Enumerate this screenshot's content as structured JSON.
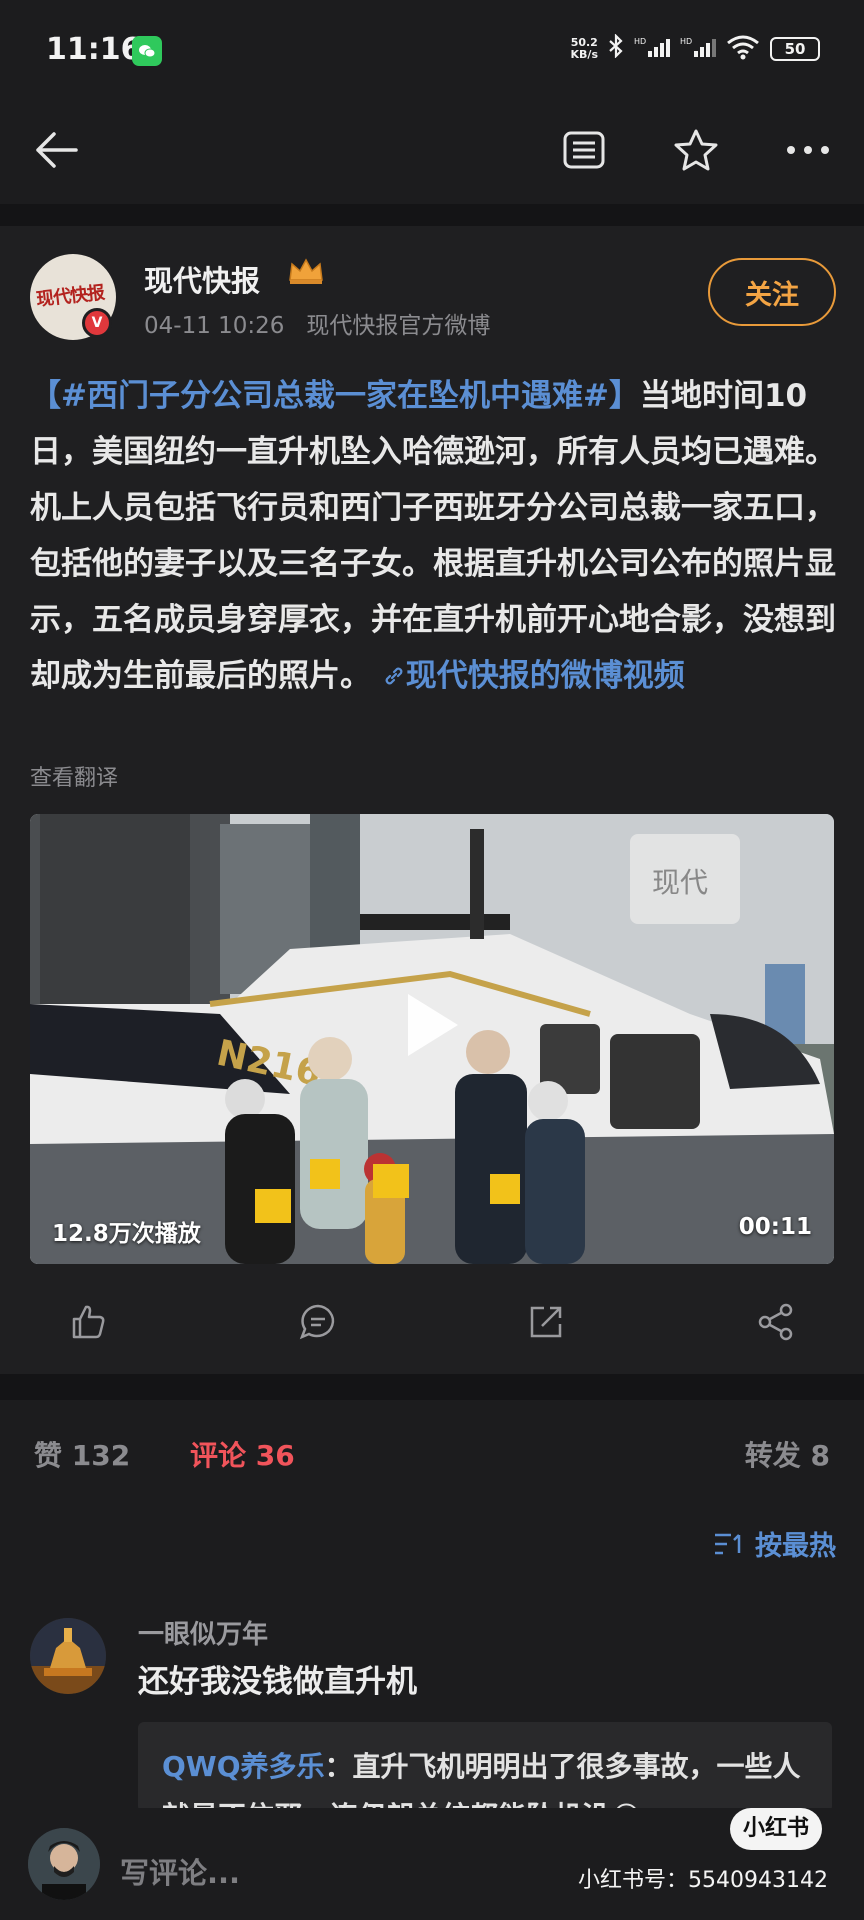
{
  "status_bar": {
    "time": "11:16",
    "net_speed_value": "50.2",
    "net_speed_unit": "KB/s",
    "battery": "50",
    "wechat_icon": "wechat-icon"
  },
  "toolbar": {
    "back_icon": "back-arrow-icon",
    "reader_icon": "reader-mode-icon",
    "star_icon": "favorite-star-icon",
    "more_icon": "more-dots-icon"
  },
  "post": {
    "author": "现代快报",
    "avatar_text": "现代快报",
    "verified_badge": "V",
    "time": "04-11 10:26",
    "source": "现代快报官方微博",
    "follow_label": "关注",
    "topic": "【#西门子分公司总裁一家在坠机中遇难#】",
    "body": "当地时间10日，美国纽约一直升机坠入哈德逊河，所有人员均已遇难。机上人员包括飞行员和西门子西班牙分公司总裁一家五口，包括他的妻子以及三名子女。根据直升机公司公布的照片显示，五名成员身穿厚衣，并在直升机前开心地合影，没想到却成为生前最后的照片。",
    "link_text": "现代快报的微博视频",
    "translate_label": "查看翻译",
    "video": {
      "plays": "12.8万次播放",
      "duration": "00:11",
      "watermark": "现代",
      "heli_reg": "N216"
    }
  },
  "stats_tabs": {
    "likes": "赞 132",
    "comments": "评论 36",
    "reposts": "转发 8",
    "sort_label": "按最热"
  },
  "comments": [
    {
      "user": "一眼似万年",
      "text": "还好我没钱做直升机",
      "reply": {
        "user": "QWQ养多乐",
        "text": "：直升飞机明明出了很多事故，一些人就是不信邪，连伊朗总统都能坠机没😂"
      }
    }
  ],
  "bottom": {
    "placeholder": "写评论...",
    "xhs_logo": "小红书",
    "xhs_id": "小红书号：5540943142"
  },
  "colors": {
    "background": "#1c1c1e",
    "accent_link": "#5b8fd4",
    "follow_orange": "#f3a444",
    "active_tab_red": "#f1545b"
  }
}
